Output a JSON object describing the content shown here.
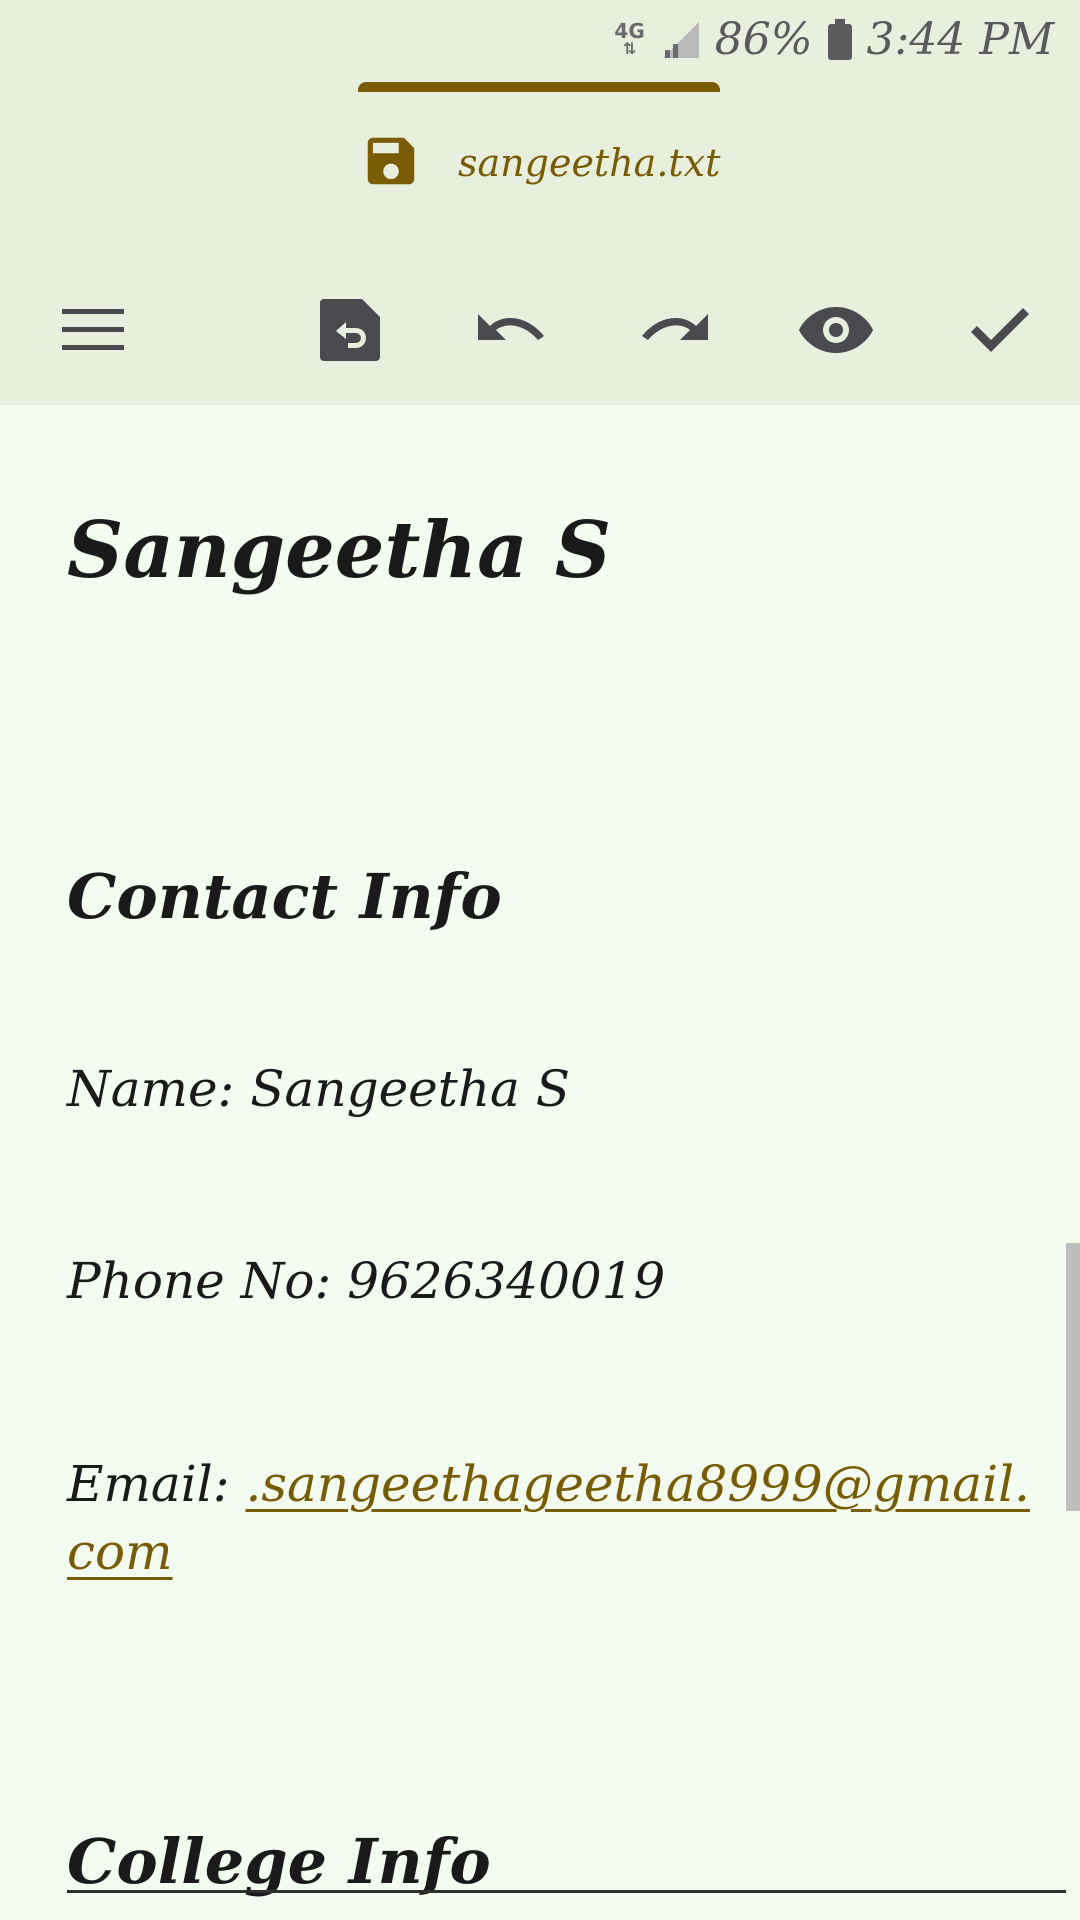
{
  "status_bar": {
    "network": "4G",
    "battery": "86%",
    "time": "3:44 PM"
  },
  "app_bar": {
    "file_name": "sangeetha.txt",
    "icons": [
      "menu-icon",
      "revert-file-icon",
      "undo-icon",
      "redo-icon",
      "preview-icon",
      "check-icon"
    ]
  },
  "document": {
    "title": "Sangeetha S",
    "section_contact": "Contact Info",
    "name_line": "Name: Sangeetha S",
    "phone_line": "Phone No: 9626340019",
    "email_label": "Email: ",
    "email_link": ".sangeethageetha8999@gmail.com",
    "section_college": "College Info"
  },
  "colors": {
    "accent": "#7a5c00",
    "topbar_bg": "#e8efdf",
    "content_bg": "#f4fcf2",
    "icon_gray": "#4a4a4f"
  }
}
